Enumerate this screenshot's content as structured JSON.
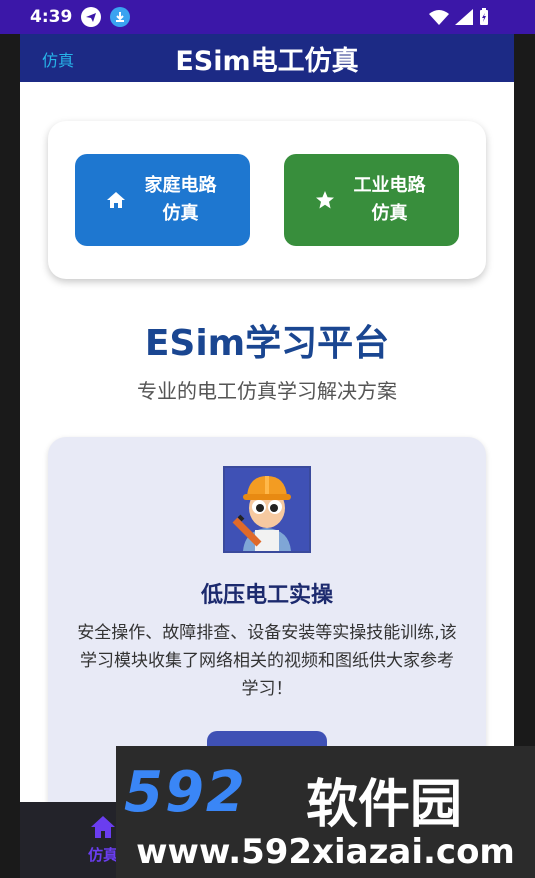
{
  "status_bar": {
    "time": "4:39",
    "icons": [
      "telegram-icon",
      "download-icon",
      "wifi-icon",
      "signal-icon",
      "battery-icon"
    ]
  },
  "app_bar": {
    "back_label": "仿真",
    "title": "ESim电工仿真"
  },
  "simulation": {
    "home_button": {
      "label": "家庭电路\n仿真",
      "icon": "home-icon"
    },
    "industry_button": {
      "label": "工业电路\n仿真",
      "icon": "star-icon"
    }
  },
  "platform": {
    "title": "ESim学习平台",
    "subtitle": "专业的电工仿真学习解决方案"
  },
  "module": {
    "title": "低压电工实操",
    "description": "安全操作、故障排查、设备安装等实操技能训练,该学习模块收集了网络相关的视频和图纸供大家参考学习！",
    "image_icon": "electrician-worker-icon"
  },
  "bottom_nav": {
    "items": [
      {
        "label": "仿真",
        "icon": "home-icon"
      }
    ]
  },
  "watermark": {
    "logo_number": "592",
    "logo_text": "软件园",
    "url": "www.592xiazai.com"
  },
  "colors": {
    "status_bar": "#3b17a8",
    "app_bar": "#1c2a85",
    "home_button": "#1e77d0",
    "industry_button": "#388e3c",
    "title_blue": "#1a4691",
    "module_card": "#e8eaf6",
    "nav_active": "#6a3df0"
  }
}
